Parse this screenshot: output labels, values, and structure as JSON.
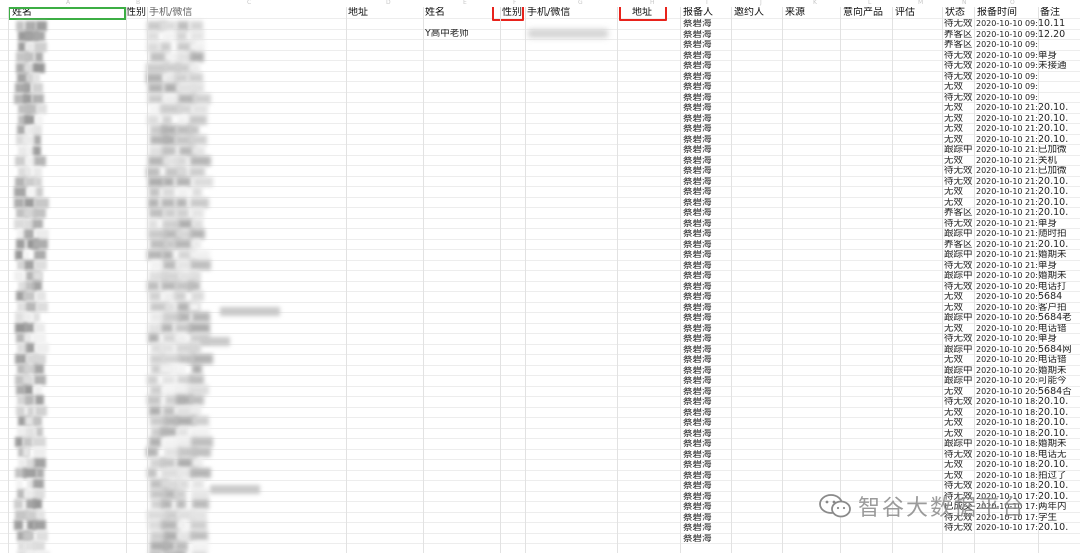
{
  "headers": {
    "left_name": "姓名",
    "left_gender": "性别",
    "left_phone": "手机/微信",
    "left_address": "地址",
    "mid_name": "姓名",
    "mid_gender": "性别",
    "mid_phone": "手机/微信",
    "mid_address": "地址",
    "reporter": "报备人",
    "inviter": "邀约人",
    "source": "来源",
    "product": "意向产品",
    "evaluation": "评估",
    "status": "状态",
    "report_time": "报备时间",
    "remark": "备注"
  },
  "first_entry_name": "Y高中老师",
  "reporter_name": "蔡碧海",
  "rows": [
    {
      "status": "待无效",
      "time": "2020-10-10 09:48",
      "remark": "10.11"
    },
    {
      "status": "养客区",
      "time": "2020-10-10 09:48",
      "remark": "12.20"
    },
    {
      "status": "养客区",
      "time": "2020-10-10 09:48",
      "remark": ""
    },
    {
      "status": "待无效",
      "time": "2020-10-10 09:46",
      "remark": "单身"
    },
    {
      "status": "待无效",
      "time": "2020-10-10 09:46",
      "remark": "未接通"
    },
    {
      "status": "待无效",
      "time": "2020-10-10 09:44",
      "remark": ""
    },
    {
      "status": "无效",
      "time": "2020-10-10 09:43",
      "remark": ""
    },
    {
      "status": "待无效",
      "time": "2020-10-10 09:42",
      "remark": ""
    },
    {
      "status": "无效",
      "time": "2020-10-10 21:33",
      "remark": "20.10."
    },
    {
      "status": "无效",
      "time": "2020-10-10 21:33",
      "remark": "20.10."
    },
    {
      "status": "无效",
      "time": "2020-10-10 21:32",
      "remark": "20.10."
    },
    {
      "status": "无效",
      "time": "2020-10-10 21:28",
      "remark": "20.10."
    },
    {
      "status": "跟踪中",
      "time": "2020-10-10 21:27",
      "remark": "已加微"
    },
    {
      "status": "无效",
      "time": "2020-10-10 21:26",
      "remark": "关机"
    },
    {
      "status": "待无效",
      "time": "2020-10-10 21:26",
      "remark": "已加微"
    },
    {
      "status": "待无效",
      "time": "2020-10-10 21:21",
      "remark": "20.10."
    },
    {
      "status": "无效",
      "time": "2020-10-10 21:20",
      "remark": "20.10."
    },
    {
      "status": "无效",
      "time": "2020-10-10 21:20",
      "remark": "20.10."
    },
    {
      "status": "养客区",
      "time": "2020-10-10 21:18",
      "remark": "20.10."
    },
    {
      "status": "待无效",
      "time": "2020-10-10 21:03",
      "remark": "单身"
    },
    {
      "status": "跟踪中",
      "time": "2020-10-10 21:02",
      "remark": "随时拍"
    },
    {
      "status": "养客区",
      "time": "2020-10-10 21:01",
      "remark": "20.10."
    },
    {
      "status": "跟踪中",
      "time": "2020-10-10 21:00",
      "remark": "婚期未"
    },
    {
      "status": "待无效",
      "time": "2020-10-10 21:00",
      "remark": "单身"
    },
    {
      "status": "跟踪中",
      "time": "2020-10-10 20:59",
      "remark": "婚期未"
    },
    {
      "status": "待无效",
      "time": "2020-10-10 20:59",
      "remark": "电话打"
    },
    {
      "status": "无效",
      "time": "2020-10-10 20:10",
      "remark": "5684"
    },
    {
      "status": "无效",
      "time": "2020-10-10 20:07",
      "remark": "客户拍"
    },
    {
      "status": "跟踪中",
      "time": "2020-10-10 20:05",
      "remark": "5684老"
    },
    {
      "status": "无效",
      "time": "2020-10-10 20:04",
      "remark": "电话错"
    },
    {
      "status": "待无效",
      "time": "2020-10-10 20:04",
      "remark": "单身"
    },
    {
      "status": "跟踪中",
      "time": "2020-10-10 20:03",
      "remark": "5684网"
    },
    {
      "status": "无效",
      "time": "2020-10-10 20:03",
      "remark": "电话错"
    },
    {
      "status": "跟踪中",
      "time": "2020-10-10 20:03",
      "remark": "婚期未"
    },
    {
      "status": "跟踪中",
      "time": "2020-10-10 20:02",
      "remark": "可能今"
    },
    {
      "status": "无效",
      "time": "2020-10-10 20:01",
      "remark": "5684否"
    },
    {
      "status": "待无效",
      "time": "2020-10-10 18:48",
      "remark": "20.10."
    },
    {
      "status": "无效",
      "time": "2020-10-10 18:46",
      "remark": "20.10."
    },
    {
      "status": "无效",
      "time": "2020-10-10 18:45",
      "remark": "20.10."
    },
    {
      "status": "无效",
      "time": "2020-10-10 18:18",
      "remark": "20.10."
    },
    {
      "status": "跟踪中",
      "time": "2020-10-10 18:08",
      "remark": "婚期未"
    },
    {
      "status": "待无效",
      "time": "2020-10-10 18:03",
      "remark": "电话无"
    },
    {
      "status": "无效",
      "time": "2020-10-10 18:02",
      "remark": "20.10."
    },
    {
      "status": "无效",
      "time": "2020-10-10 18:00",
      "remark": "拍过了"
    },
    {
      "status": "待无效",
      "time": "2020-10-10 18:00",
      "remark": "20.10."
    },
    {
      "status": "待无效",
      "time": "2020-10-10 17:59",
      "remark": "20.10."
    },
    {
      "status": "已成交",
      "time": "2020-10-10 17:59",
      "remark": "两年内"
    },
    {
      "status": "待无效",
      "time": "2020-10-10 17:59",
      "remark": "学生"
    },
    {
      "status": "待无效",
      "time": "2020-10-10 17:59",
      "remark": "20.10."
    },
    {
      "status": "",
      "time": "",
      "remark": ""
    }
  ],
  "watermark": {
    "text": "智谷大数据平台",
    "icon": "wechat-icon"
  },
  "colors": {
    "highlight_red": "#e8231c",
    "selection_green": "#3cae44",
    "grid_line": "#e2e2e2",
    "watermark": "#8a8a8a"
  }
}
